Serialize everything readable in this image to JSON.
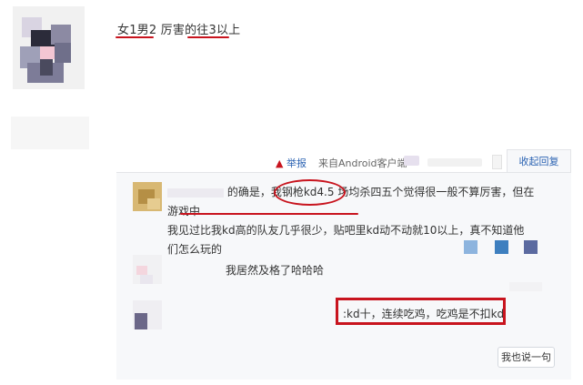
{
  "post": {
    "text": "女1男2 厉害的往3以上"
  },
  "meta": {
    "report_label": "举报",
    "source_label": "来自Android客户端"
  },
  "reply_tab": {
    "label": "收起回复"
  },
  "comments": [
    {
      "line1_a": "的确是，",
      "line1_b": "我钢枪kd4.5",
      "line1_c": " 场均杀四五个觉得很一般不算厉害，但在",
      "line2_a": "游戏中",
      "line2_b": "我见过比我kd高的队友几乎很少",
      "line2_c": "，贴吧里kd动不动就10以上，真不知道他",
      "line3": "们怎么玩的"
    },
    {
      "text": "我居然及格了哈哈哈"
    },
    {
      "text": ":kd十，连续吃鸡，吃鸡是不扣kd"
    }
  ],
  "reply_button": {
    "label": "我也说一句"
  },
  "colors": {
    "annotation_red": "#c8141e",
    "link_blue": "#2d64b3",
    "panel_bg": "#f7f8fa"
  }
}
